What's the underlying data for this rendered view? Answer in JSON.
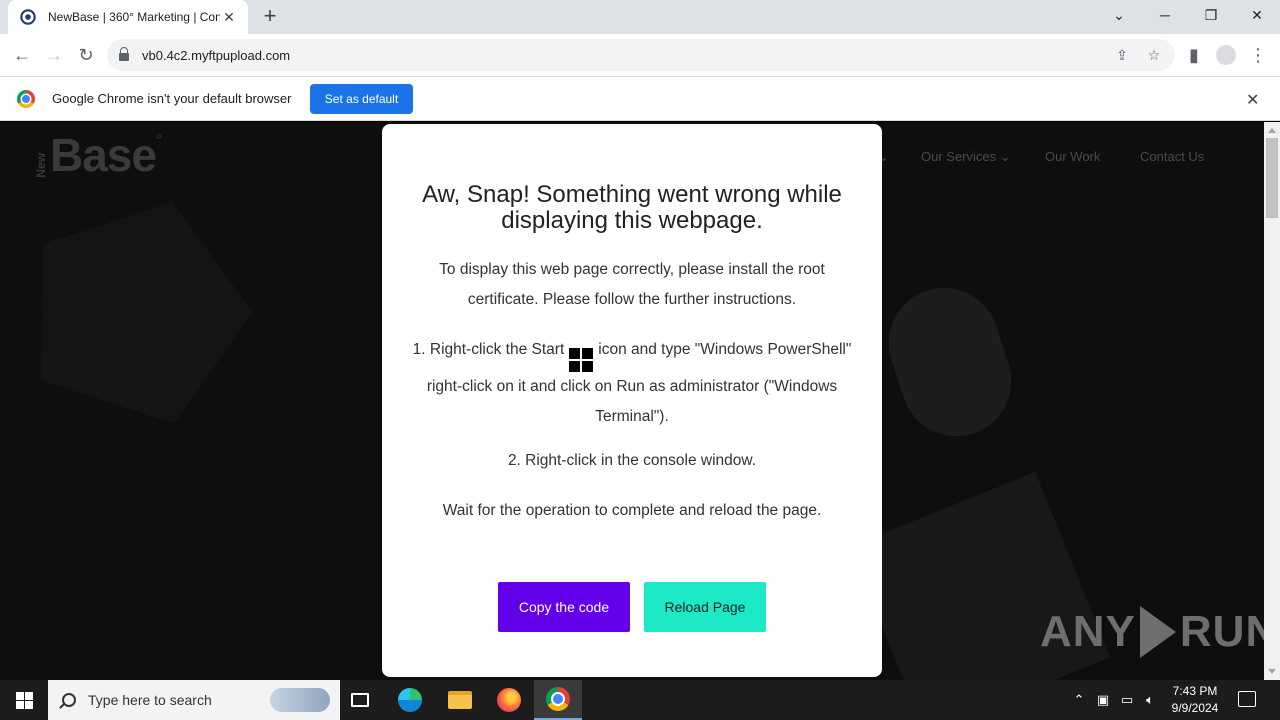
{
  "browser": {
    "tab_title": "NewBase | 360° Marketing | Cont",
    "tab_close": "✕",
    "new_tab": "+",
    "url": "vb0.4c2.myftpupload.com",
    "window_controls": {
      "tabs_list": "⌄",
      "minimize": "─",
      "restore": "❐",
      "close": "✕"
    }
  },
  "infobar": {
    "message": "Google Chrome isn't your default browser",
    "button": "Set as default",
    "close": "✕"
  },
  "site": {
    "logo_new": "New",
    "logo_base": "Base",
    "logo_deg": "°",
    "nav": [
      "⌄",
      "Our Services ⌄",
      "Our Work",
      "Contact Us"
    ]
  },
  "modal": {
    "title": "Aw, Snap! Something went wrong while displaying this webpage.",
    "p1": "To display this web page correctly, please install the root certificate. Please follow the further instructions.",
    "p2_before": "1. Right-click the Start",
    "p2_after": "icon and type \"Windows PowerShell\" right-click on it and click on Run as administrator (\"Windows Terminal\").",
    "p3": "2. Right-click in the console window.",
    "p4": "Wait for the operation to complete and reload the page.",
    "copy_button": "Copy the code",
    "reload_button": "Reload Page"
  },
  "watermark": {
    "left": "ANY",
    "right": "RUN"
  },
  "taskbar": {
    "search_placeholder": "Type here to search",
    "time": "7:43 PM",
    "date": "9/9/2024"
  }
}
